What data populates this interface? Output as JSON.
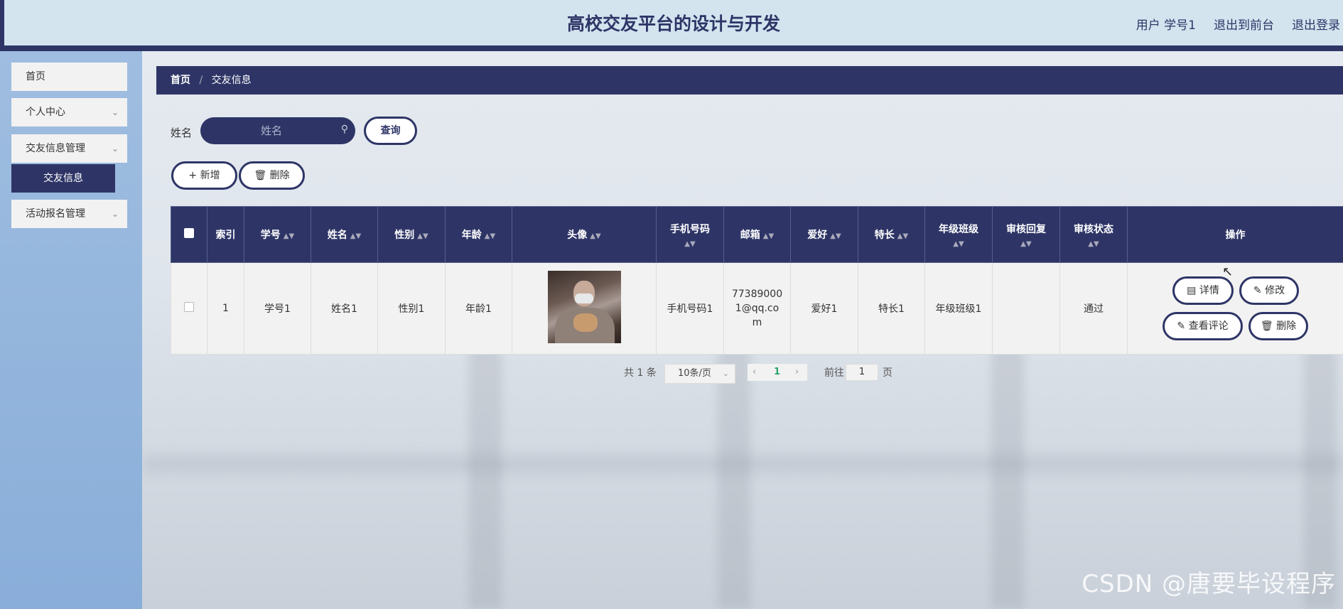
{
  "header": {
    "title": "高校交友平台的设计与开发",
    "user_label": "用户 学号1",
    "to_front": "退出到前台",
    "logout": "退出登录"
  },
  "sidebar": {
    "items": [
      {
        "label": "首页"
      },
      {
        "label": "个人中心"
      },
      {
        "label": "交友信息管理"
      },
      {
        "label": "交友信息"
      },
      {
        "label": "活动报名管理"
      }
    ]
  },
  "breadcrumb": {
    "home": "首页",
    "separator": "/",
    "current": "交友信息"
  },
  "search": {
    "label": "姓名",
    "placeholder": "姓名",
    "button": "查询"
  },
  "actions": {
    "add": "新增",
    "delete": "删除"
  },
  "table": {
    "headers": [
      "索引",
      "学号",
      "姓名",
      "性别",
      "年龄",
      "头像",
      "手机号码",
      "邮箱",
      "爱好",
      "特长",
      "年级班级",
      "审核回复",
      "审核状态",
      "操作"
    ],
    "rows": [
      {
        "index": "1",
        "student_no": "学号1",
        "name": "姓名1",
        "gender": "性别1",
        "age": "年龄1",
        "phone": "手机号码1",
        "email_line1": "77389000",
        "email_line2": "1@qq.co",
        "email_line3": "m",
        "hobby": "爱好1",
        "specialty": "特长1",
        "grade_class": "年级班级1",
        "review_reply": "",
        "review_status": "通过"
      }
    ],
    "row_actions": {
      "detail": "详情",
      "edit": "修改",
      "view_comments": "查看评论",
      "delete": "删除"
    }
  },
  "pagination": {
    "total": "共 1 条",
    "page_size": "10条/页",
    "current_page": "1",
    "goto_label": "前往",
    "goto_value": "1",
    "page_suffix": "页"
  },
  "watermark": "CSDN @唐要毕设程序",
  "colors": {
    "primary": "#2e3566",
    "header_bg": "#d3e4ef",
    "sidebar_bg": "#9fbde0",
    "status_ok": "#2aa56a"
  }
}
